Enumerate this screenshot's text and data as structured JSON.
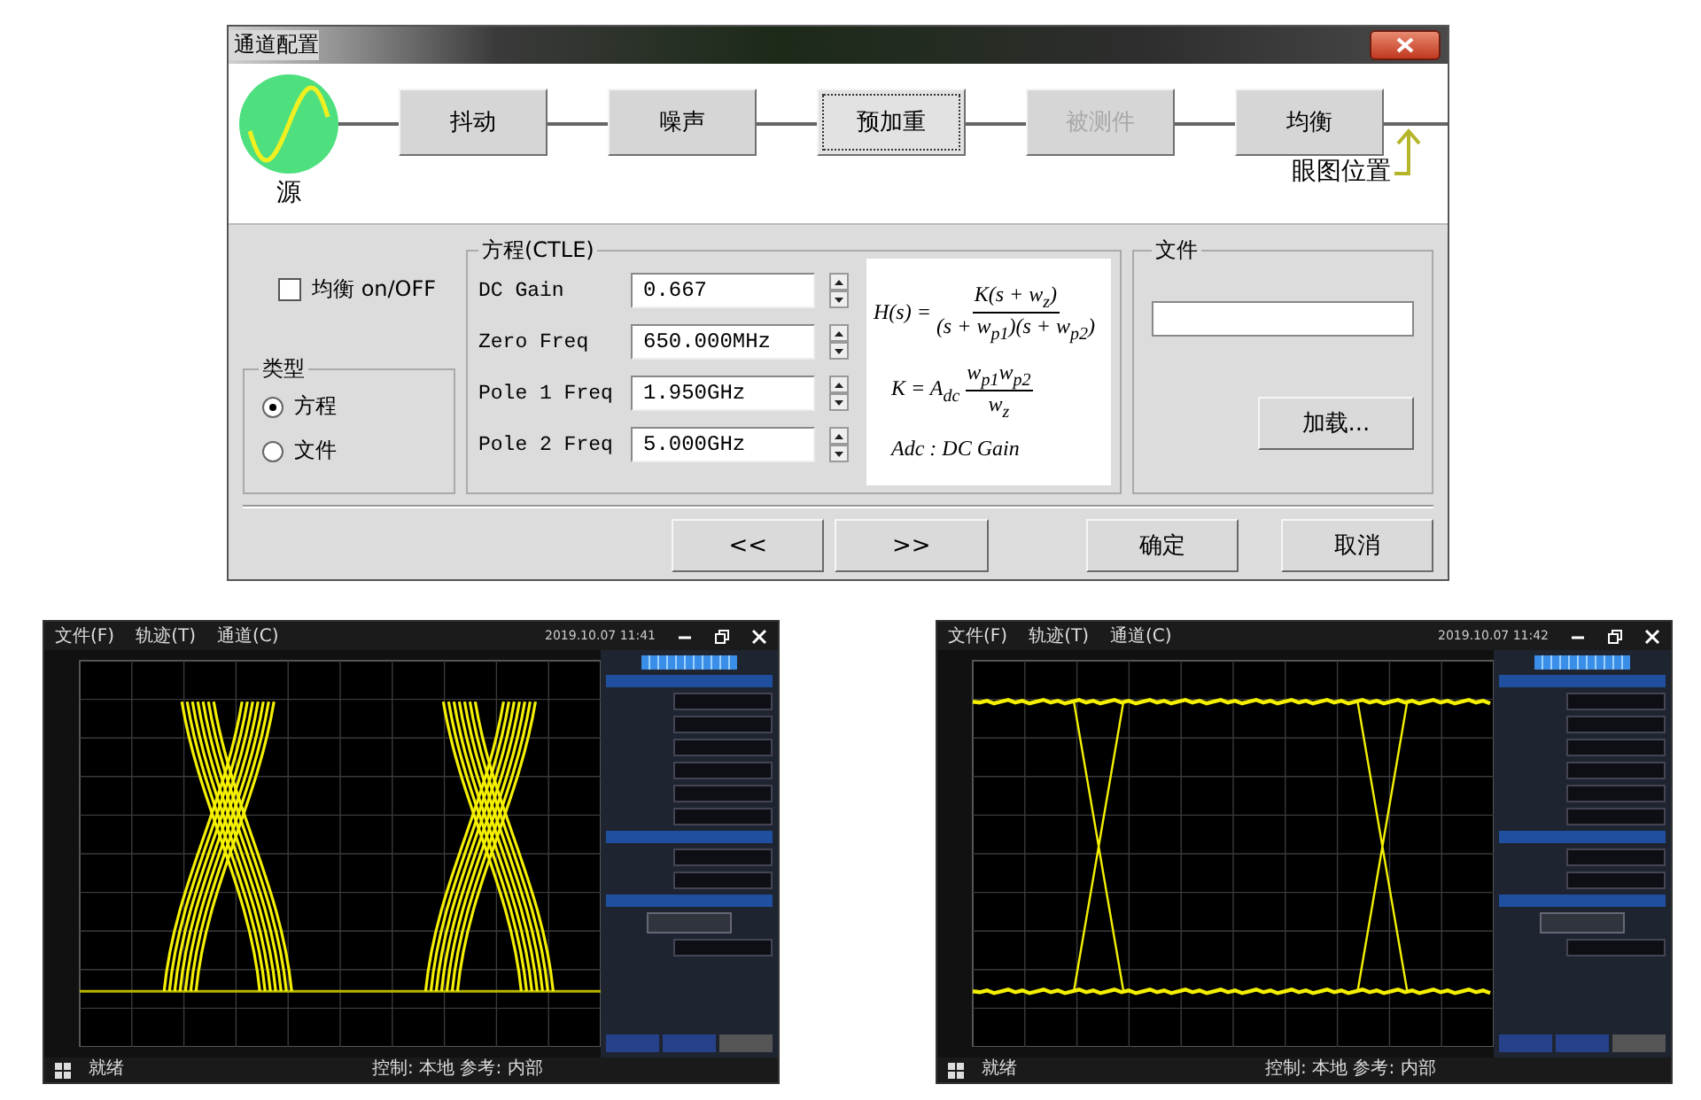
{
  "dialog": {
    "title": "通道配置",
    "chain": {
      "source": "源",
      "blocks": [
        {
          "label": "抖动",
          "selected": false,
          "disabled": false
        },
        {
          "label": "噪声",
          "selected": false,
          "disabled": false
        },
        {
          "label": "预加重",
          "selected": true,
          "disabled": false
        },
        {
          "label": "被测件",
          "selected": false,
          "disabled": true
        },
        {
          "label": "均衡",
          "selected": false,
          "disabled": false
        }
      ],
      "eye_position": "眼图位置"
    },
    "equalize": {
      "label": "均衡 on/OFF",
      "checked": false
    },
    "type_group": {
      "title": "类型",
      "options": [
        {
          "label": "方程",
          "selected": true
        },
        {
          "label": "文件",
          "selected": false
        }
      ]
    },
    "ctle": {
      "title": "方程(CTLE)",
      "fields": [
        {
          "label": "DC Gain",
          "value": "0.667"
        },
        {
          "label": "Zero Freq",
          "value": "650.000MHz"
        },
        {
          "label": "Pole 1 Freq",
          "value": "1.950GHz"
        },
        {
          "label": "Pole 2 Freq",
          "value": "5.000GHz"
        }
      ],
      "formula": {
        "h_lhs": "H(s) =",
        "h_num": "K(s + w$_{z}$)",
        "h_den": "(s + w$_{p1}$)(s + w$_{p2}$)",
        "k_lhs": "K = A$_{dc}$",
        "k_num": "w$_{p1}$w$_{p2}$",
        "k_den": "w$_{z}$",
        "note": "Adc : DC Gain"
      }
    },
    "file": {
      "title": "文件",
      "button": "加载..."
    },
    "buttons": [
      "<<",
      ">>",
      "确定",
      "取消"
    ]
  },
  "scopes": [
    {
      "menu": [
        "文件(F)",
        "轨迹(T)",
        "通道(C)"
      ],
      "time": "2019.10.07 11:41",
      "status": "就绪",
      "status_info": "控制: 本地  参考: 内部",
      "eye": {
        "kind": "dense"
      },
      "panel_tabs": [
        {
          "selected": false
        },
        {
          "selected": false
        },
        {
          "selected": true
        }
      ]
    },
    {
      "menu": [
        "文件(F)",
        "轨迹(T)",
        "通道(C)"
      ],
      "time": "2019.10.07 11:42",
      "status": "就绪",
      "status_info": "控制: 本地  参考: 内部",
      "eye": {
        "kind": "clean"
      },
      "panel_tabs": [
        {
          "selected": false
        },
        {
          "selected": false
        },
        {
          "selected": true
        }
      ]
    }
  ]
}
